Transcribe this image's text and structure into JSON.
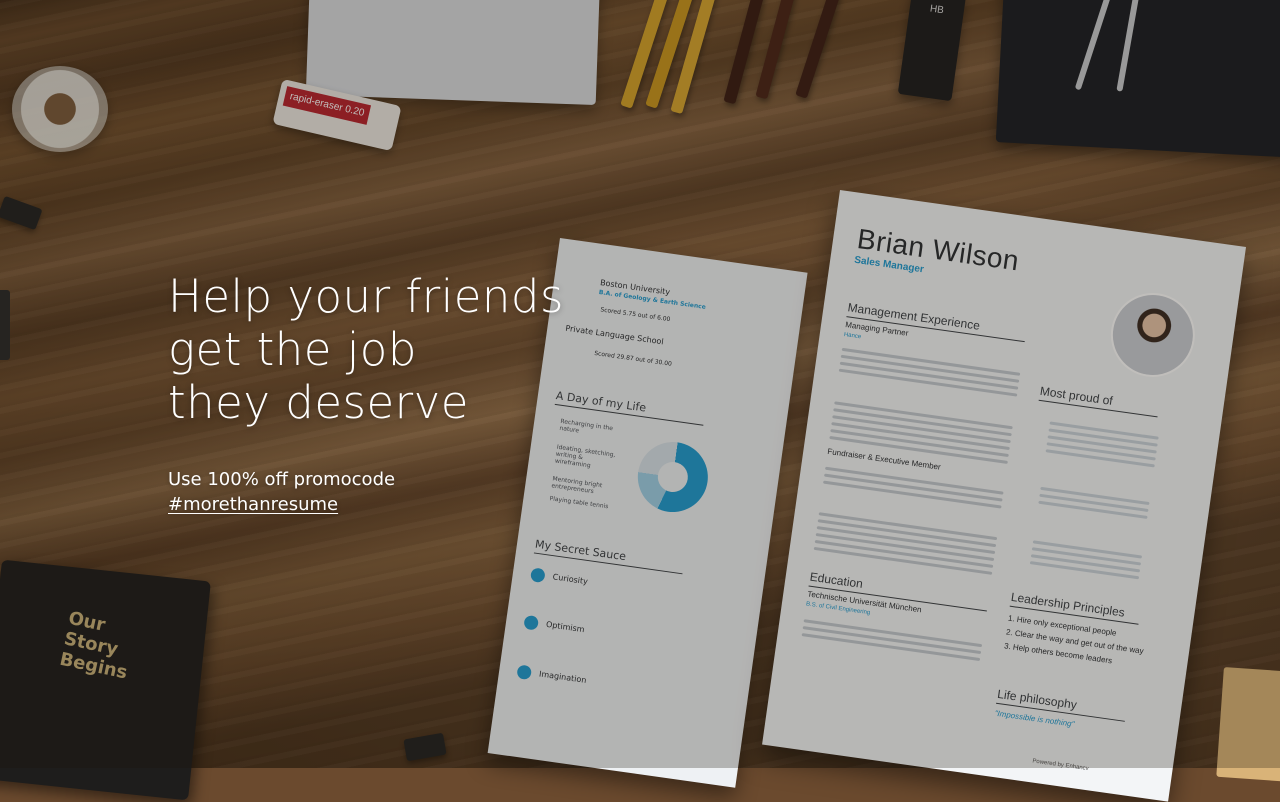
{
  "hero": {
    "headline_lines": [
      "Help your friends",
      "get the job",
      "they deserve"
    ],
    "promo_text": "Use 100% off promocode",
    "promo_code": "#morethanresume"
  },
  "desk_items": {
    "eraser_label": "rapid-eraser 0.20",
    "lead_case_label": "HB",
    "book_title_lines": [
      "Our",
      "Story",
      "Begins"
    ]
  },
  "resume_front": {
    "name": "Brian Wilson",
    "role": "Sales Manager",
    "sections": {
      "management": "Management Experience",
      "proud": "Most proud of",
      "education": "Education",
      "leadership": "Leadership Principles",
      "life": "Life philosophy"
    },
    "job1_title": "Managing Partner",
    "job1_company": "Hance",
    "job2_title": "Fundraiser & Executive Member",
    "school": "Technische Universität München",
    "degree": "B.S. of Civil Engineering",
    "leadership_items": [
      "1. Hire only exceptional people",
      "2. Clear the way and get out of the way",
      "3. Help others become leaders"
    ],
    "life_quote": "\"Impossible is nothing\"",
    "powered_by": "Powered by Enhancv"
  },
  "resume_back": {
    "university": "Boston University",
    "degree": "B.A. of Geology & Earth Science",
    "score1": "Scored 5.75 out of 6.00",
    "school2": "Private Language School",
    "score2": "Scored 29.87 out of 30.00",
    "sections": {
      "day": "A Day of my Life",
      "sauce": "My Secret Sauce"
    },
    "day_items": [
      "Recharging in the nature",
      "Ideating, sketching, writing & wireframing",
      "Mentoring bright entrepreneurs",
      "Playing table tennis"
    ],
    "sauce_items": [
      "Curiosity",
      "Optimism",
      "Imagination"
    ]
  },
  "colors": {
    "accent": "#1f9bd1",
    "hero_text": "#ffffff",
    "overlay": "rgba(30,20,12,0.28)"
  }
}
